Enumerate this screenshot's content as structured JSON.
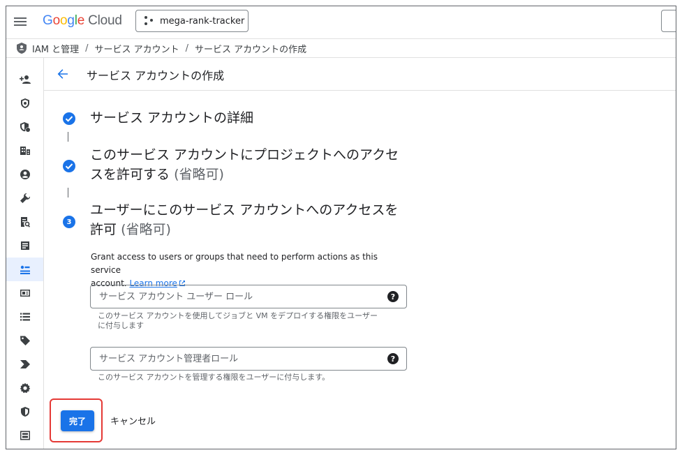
{
  "topbar": {
    "logo_brand": "Google",
    "logo_product": "Cloud",
    "project_name": "mega-rank-tracker"
  },
  "breadcrumb": {
    "items": [
      "IAM と管理",
      "サービス アカウント",
      "サービス アカウントの作成"
    ],
    "separator": "/"
  },
  "header": {
    "title": "サービス アカウントの作成"
  },
  "steps": [
    {
      "status": "done",
      "title": "サービス アカウントの詳細",
      "optional": ""
    },
    {
      "status": "done",
      "title_line1": "このサービス アカウントにプロジェクトへのアクセ",
      "title_line2": "スを許可する",
      "optional": "(省略可)"
    },
    {
      "status": "active",
      "number": "3",
      "title_line1": "ユーザーにこのサービス アカウントへのアクセスを",
      "title_line2": "許可",
      "optional": "(省略可)"
    }
  ],
  "grant": {
    "description_line1": "Grant access to users or groups that need to perform actions as this service",
    "description_line2": "account.",
    "learn_more": "Learn more"
  },
  "fields": {
    "users_role": {
      "placeholder": "サービス アカウント ユーザー ロール",
      "value": "",
      "hint_line1": "このサービス アカウントを使用してジョブと VM をデプロイする権限をユーザー",
      "hint_line2": "に付与します"
    },
    "admins_role": {
      "placeholder": "サービス アカウント管理者ロール",
      "value": "",
      "hint": "このサービス アカウントを管理する権限をユーザーに付与します。"
    },
    "help_symbol": "?"
  },
  "actions": {
    "done": "完了",
    "cancel": "キャンセル"
  },
  "rail_icons": [
    "person-add-icon",
    "shield-icon",
    "policy-icon",
    "org-icon",
    "account-icon",
    "wrench-icon",
    "audit-icon",
    "document-icon",
    "service-account-icon",
    "card-icon",
    "list-icon",
    "tag-icon",
    "chevron-right-icon",
    "settings-icon",
    "security-icon",
    "dashboard-icon"
  ],
  "colors": {
    "accent": "#1a73e8",
    "highlight_box": "#e53935",
    "active_rail": "#e8f0fe"
  }
}
